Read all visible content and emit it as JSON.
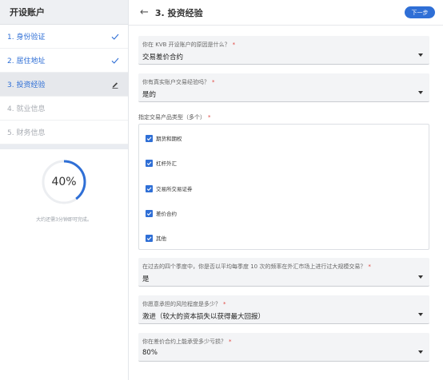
{
  "sidebar": {
    "title": "开设账户",
    "steps": [
      {
        "label": "1. 身份验证",
        "state": "done",
        "icon": "checkmark-icon"
      },
      {
        "label": "2. 居住地址",
        "state": "done",
        "icon": "checkmark-icon"
      },
      {
        "label": "3. 投资经验",
        "state": "active",
        "icon": "pencil-icon"
      },
      {
        "label": "4. 就业信息",
        "state": "todo"
      },
      {
        "label": "5. 财务信息",
        "state": "todo"
      }
    ],
    "progress": {
      "percent": 40,
      "label": "40%",
      "eta": "大约还需3分钟即可完成。"
    }
  },
  "header": {
    "title": "3. 投资经验",
    "next_label": "下一步"
  },
  "form": {
    "q1": {
      "question": "你在 KVB 开设账户的原因是什么？",
      "value": "交易差价合约"
    },
    "q2": {
      "question": "你有真实账户交易经验吗？",
      "value": "是的"
    },
    "products": {
      "label": "指定交易产品类型（多个）",
      "options": [
        {
          "label": "期货和期权",
          "checked": true
        },
        {
          "label": "杠杆外汇",
          "checked": true
        },
        {
          "label": "交易所交易证券",
          "checked": true
        },
        {
          "label": "差价合约",
          "checked": true
        },
        {
          "label": "其他",
          "checked": true
        }
      ]
    },
    "q3": {
      "question": "在过去的四个季度中，你是否以平均每季度 10 次的频率在外汇市场上进行过大规模交易？",
      "value": "是"
    },
    "q4": {
      "question": "你愿意承担的风险程度是多少？",
      "value": "激进（较大的资本损失以获得最大回报）"
    },
    "q5": {
      "question": "你在差价合约上能承受多少亏损？",
      "value": "80%"
    }
  },
  "colors": {
    "accent": "#2f6fd6",
    "required": "#e0443e"
  }
}
